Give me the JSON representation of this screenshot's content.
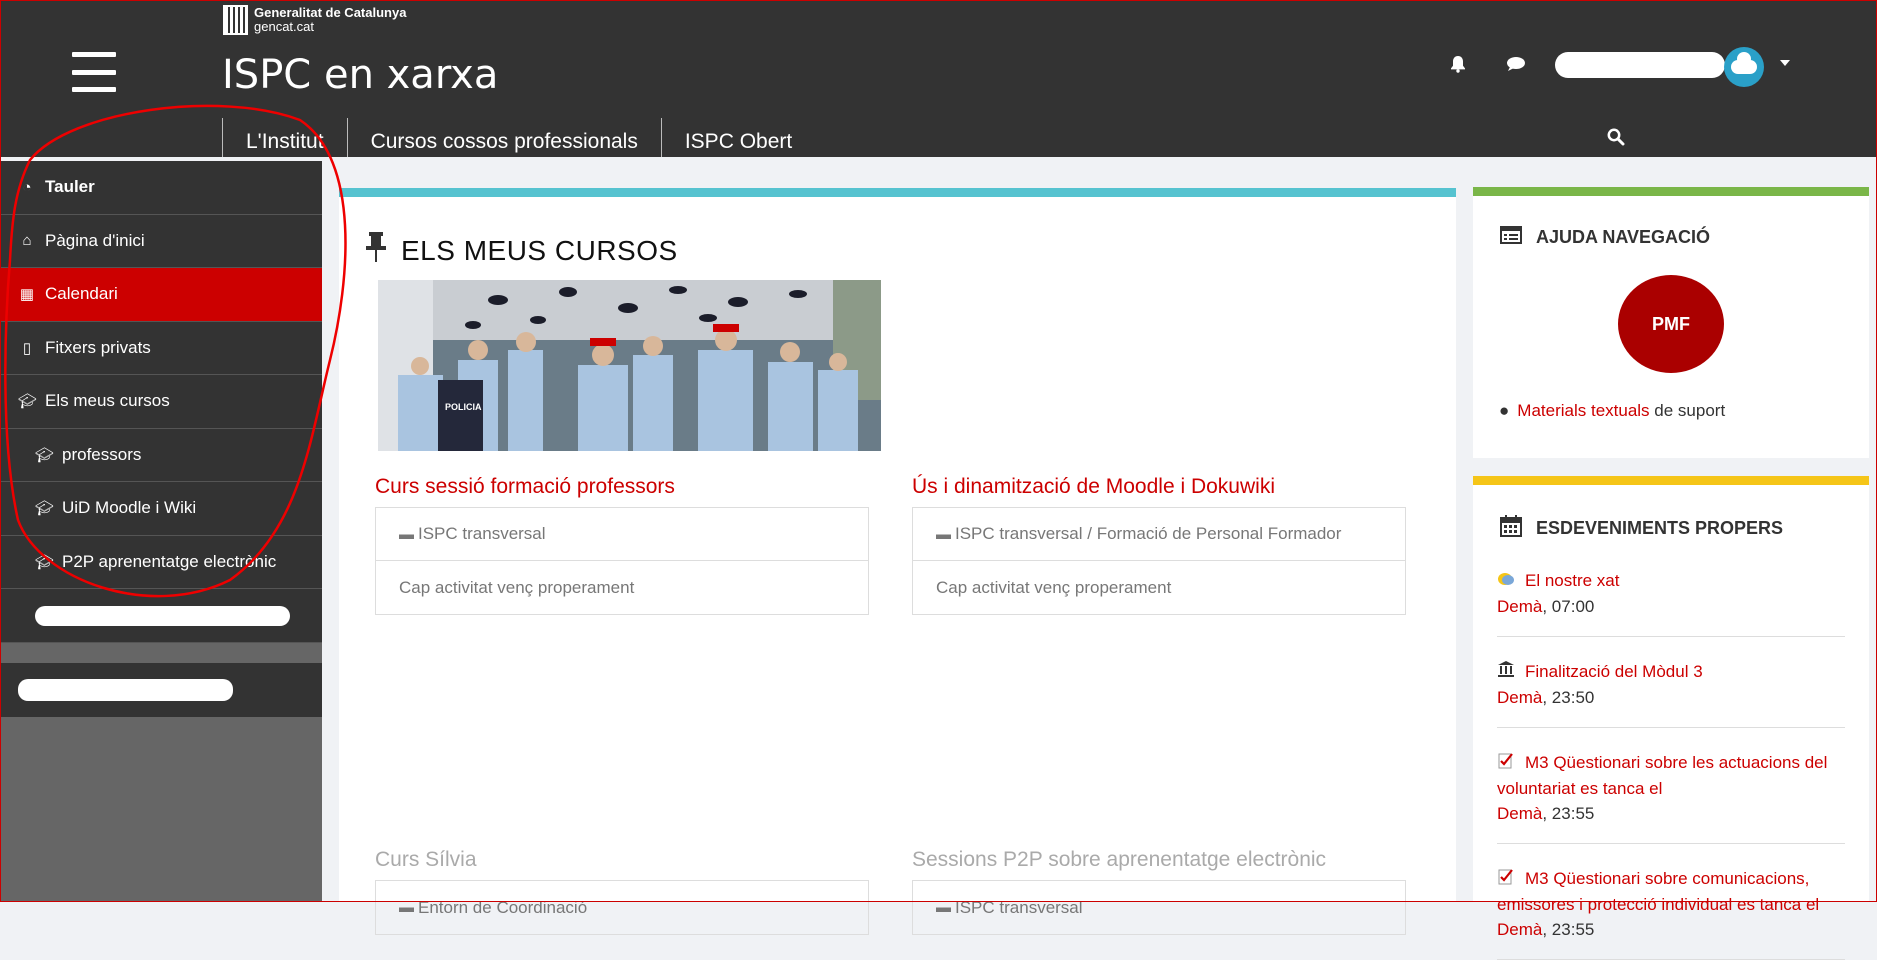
{
  "header": {
    "gencat_line1": "Generalitat de Catalunya",
    "gencat_line2": "gencat.cat",
    "site_title": "ISPC en xarxa",
    "nav": [
      {
        "label": "L'Institut"
      },
      {
        "label": "Cursos cossos professionals"
      },
      {
        "label": "ISPC Obert"
      }
    ],
    "icons": [
      "bell-icon",
      "chat-icon",
      "search-icon"
    ]
  },
  "sidebar": {
    "items": [
      {
        "label": "Tauler",
        "icon": "dashboard-icon"
      },
      {
        "label": "Pàgina d'inici",
        "icon": "home-icon"
      },
      {
        "label": "Calendari",
        "icon": "calendar-icon"
      },
      {
        "label": "Fitxers privats",
        "icon": "file-icon"
      },
      {
        "label": "Els meus cursos",
        "icon": "graduation-cap-icon"
      },
      {
        "label": "professors",
        "icon": "graduation-cap-icon"
      },
      {
        "label": "UiD Moodle i Wiki",
        "icon": "graduation-cap-icon"
      },
      {
        "label": "P2P aprenentatge electrònic",
        "icon": "graduation-cap-icon"
      }
    ]
  },
  "main": {
    "title": "ELS MEUS CURSOS",
    "image_text": "POLICIA",
    "courses": [
      {
        "name": "Curs sessió formació professors",
        "category": "ISPC transversal",
        "activity": "Cap activitat venç properament"
      },
      {
        "name": "Ús i dinamització de Moodle i Dokuwiki",
        "category": "ISPC transversal / Formació de Personal Formador",
        "activity": "Cap activitat venç properament"
      },
      {
        "name": "Curs Sílvia",
        "category": "Entorn de Coordinació"
      },
      {
        "name": "Sessions P2P sobre aprenentatge electrònic",
        "category": "ISPC transversal"
      }
    ]
  },
  "help_block": {
    "title": "AJUDA NAVEGACIÓ",
    "pmf": "PMF",
    "materials_link": "Materials textuals",
    "materials_rest": " de suport"
  },
  "events_block": {
    "title": "ESDEVENIMENTS PROPERS",
    "events": [
      {
        "title": "El nostre xat",
        "day": "Demà",
        "time": ", 07:00",
        "icon": "chat-bubble-icon"
      },
      {
        "title": "Finalització del Mòdul 3",
        "day": "Demà",
        "time": ", 23:50",
        "icon": "institution-icon"
      },
      {
        "title": "M3 Qüestionari sobre les actuacions del voluntariat es tanca el",
        "day": "Demà",
        "time": ", 23:55",
        "icon": "quiz-icon"
      },
      {
        "title": "M3 Qüestionari sobre comunicacions, emissores i protecció individual es tanca el",
        "day": "Demà",
        "time": ", 23:55",
        "icon": "quiz-icon"
      }
    ]
  },
  "colors": {
    "header_bg": "#333333",
    "accent_red": "#cc0000",
    "main_top": "#56c3d0",
    "help_top": "#7ab648",
    "events_top": "#f5c518"
  }
}
